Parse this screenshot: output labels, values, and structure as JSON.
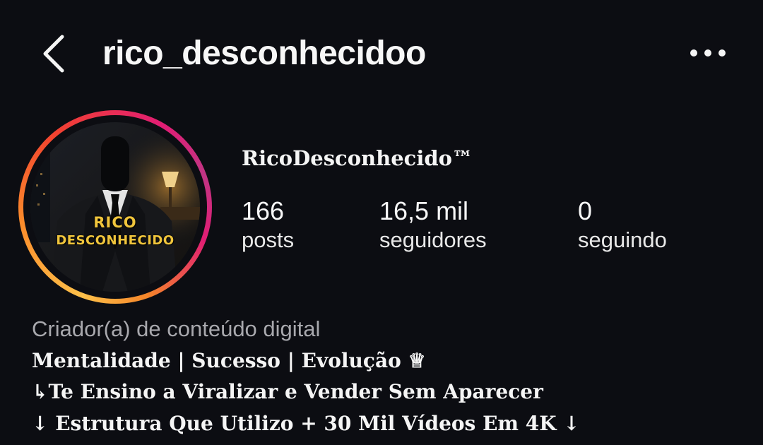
{
  "header": {
    "username": "rico_desconhecidoo",
    "back_icon": "chevron-left-icon",
    "more_icon": "more-horizontal-icon"
  },
  "profile": {
    "avatar_text_line1": "RICO",
    "avatar_text_line2": "DESCONHECIDO",
    "display_name": "RicoDesconhecido™",
    "stats": {
      "posts": {
        "value": "166",
        "label": "posts"
      },
      "followers": {
        "value": "16,5 mil",
        "label": "seguidores"
      },
      "following": {
        "value": "0",
        "label": "seguindo"
      }
    },
    "category": "Criador(a) de conteúdo digital",
    "bio": [
      "Mentalidade | Sucesso | Evolução ♕",
      "↳Te Ensino a Viralizar e Vender Sem Aparecer",
      "↓ Estrutura Que Utilizo + 30 Mil Vídeos Em 4K ↓"
    ]
  },
  "colors": {
    "background": "#0c0d12",
    "text_primary": "#f5f5f5",
    "text_secondary": "#a8a8ad",
    "story_ring": [
      "#fdc04a",
      "#f58529",
      "#e11d74",
      "#c13584"
    ],
    "avatar_text": "#f0c53c"
  }
}
